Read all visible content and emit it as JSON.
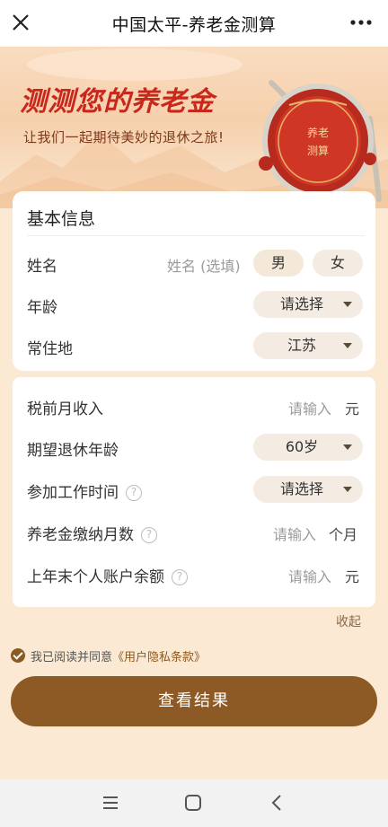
{
  "header": {
    "title": "中国太平-养老金测算",
    "close_icon": "close-icon",
    "more_icon": "more-dots-icon"
  },
  "banner": {
    "title": "测测您的养老金",
    "subtitle": "让我们一起期待美妙的退休之旅!",
    "drum_text": "养老金测算"
  },
  "basic_info": {
    "title": "基本信息",
    "name": {
      "label": "姓名",
      "placeholder": "姓名 (选填)",
      "male": "男",
      "female": "女"
    },
    "age": {
      "label": "年龄",
      "value": "请选择"
    },
    "residence": {
      "label": "常住地",
      "value": "江苏"
    }
  },
  "income": {
    "monthly_income": {
      "label": "税前月收入",
      "placeholder": "请输入",
      "unit": "元"
    },
    "retire_age": {
      "label": "期望退休年龄",
      "value": "60岁"
    },
    "work_start": {
      "label": "参加工作时间",
      "value": "请选择"
    },
    "pension_months": {
      "label": "养老金缴纳月数",
      "placeholder": "请输入",
      "unit": "个月"
    },
    "account_balance": {
      "label": "上年末个人账户余额",
      "placeholder": "请输入",
      "unit": "元"
    }
  },
  "collapse_label": "收起",
  "agreement": {
    "text": "我已阅读并同意",
    "link": "《用户隐私条款》"
  },
  "submit_label": "查看结果",
  "colors": {
    "brand_brown": "#8d5a26",
    "banner_red": "#c8271c",
    "page_bg": "#fbe9d3"
  },
  "nav": {
    "menu_icon": "menu-icon",
    "home_icon": "home-square-icon",
    "back_icon": "back-chevron-icon"
  }
}
